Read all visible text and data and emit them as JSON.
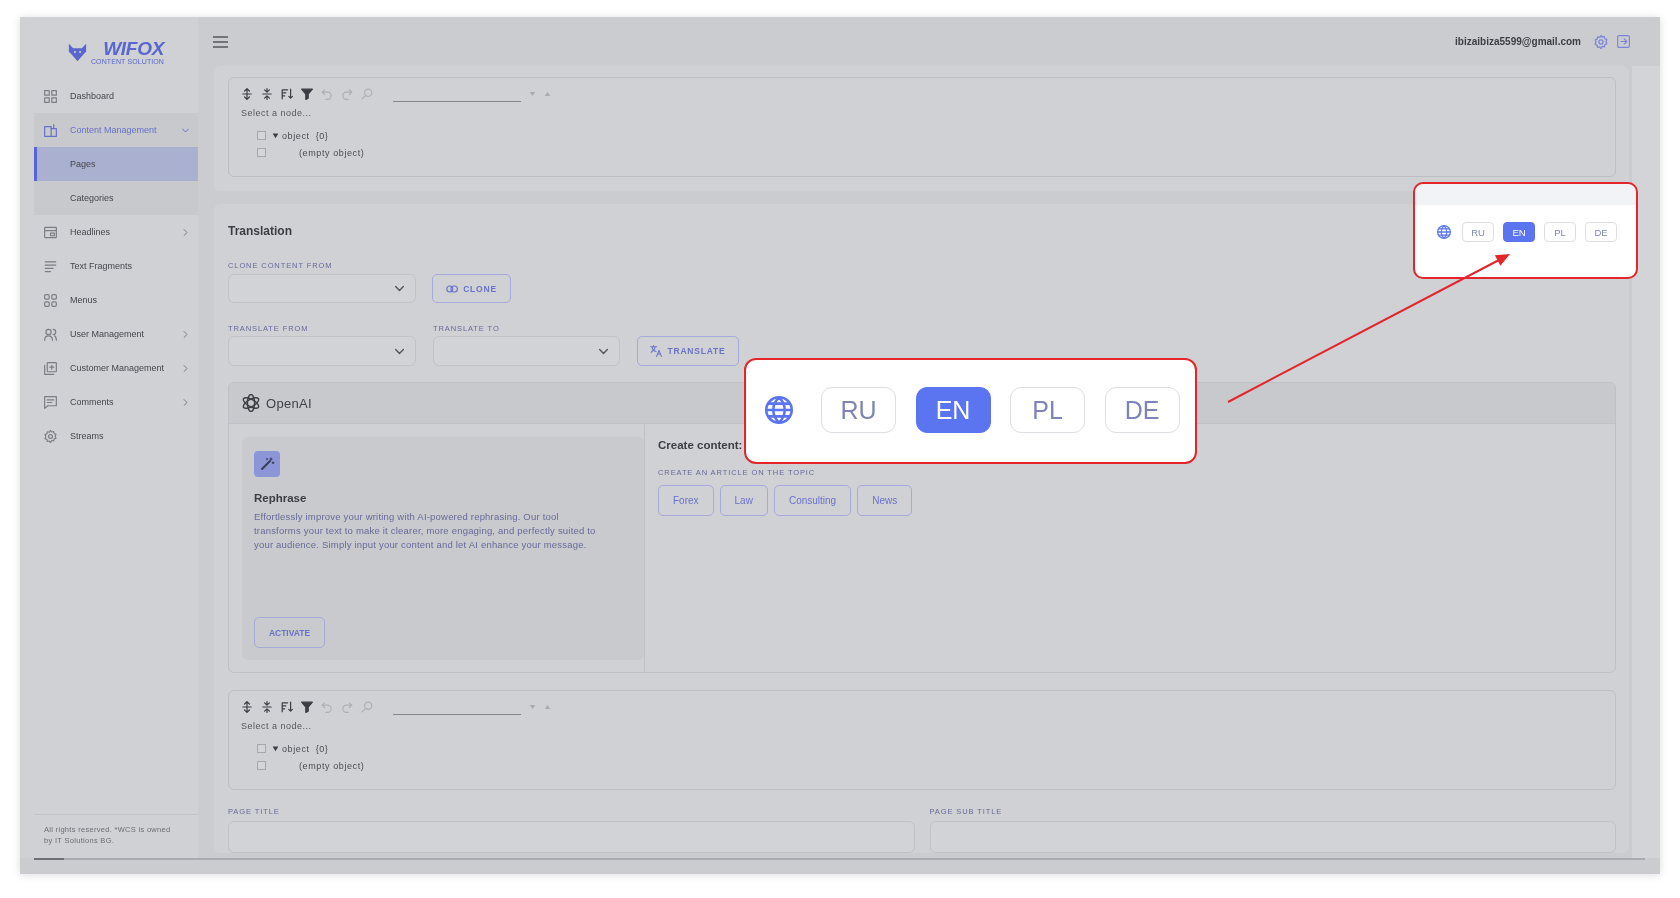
{
  "sidebar": {
    "logo": {
      "name": "WIFOX",
      "tagline": "CONTENT SOLUTION"
    },
    "items": [
      {
        "label": "Dashboard",
        "selected": false
      },
      {
        "label": "Content Management",
        "selected": false,
        "expanded": true,
        "children": [
          {
            "label": "Pages",
            "selected": true
          },
          {
            "label": "Categories",
            "selected": false
          }
        ]
      },
      {
        "label": "Headlines",
        "selected": false,
        "expanded": false
      },
      {
        "label": "Text Fragments",
        "selected": false
      },
      {
        "label": "Menus",
        "selected": false
      },
      {
        "label": "User Management",
        "selected": false,
        "expanded": false
      },
      {
        "label": "Customer Management",
        "selected": false,
        "expanded": false
      },
      {
        "label": "Comments",
        "selected": false,
        "expanded": false
      },
      {
        "label": "Streams",
        "selected": false
      }
    ],
    "footer": "All rights reserved. *WCS is owned by IT Solutions BG."
  },
  "header": {
    "user_email": "ibizaibiza5599@gmail.com"
  },
  "json_editors": [
    {
      "toolbar": [
        {
          "disabled": false
        },
        {
          "disabled": false
        },
        {
          "disabled": false
        },
        {
          "disabled": false
        },
        {
          "disabled": true
        },
        {
          "disabled": true
        },
        {
          "disabled": true
        }
      ],
      "status": "Select a node...",
      "tree": [
        {
          "label": "object",
          "count": "{0}",
          "checked": false,
          "expanded": true,
          "children": [
            {
              "label": "(empty object)",
              "checked": false
            }
          ]
        }
      ]
    },
    {
      "toolbar": [
        {
          "disabled": false
        },
        {
          "disabled": false
        },
        {
          "disabled": false
        },
        {
          "disabled": false
        },
        {
          "disabled": true
        },
        {
          "disabled": true
        },
        {
          "disabled": true
        }
      ],
      "status": "Select a node...",
      "tree": [
        {
          "label": "object",
          "count": "{0}",
          "checked": false,
          "expanded": true,
          "children": [
            {
              "label": "(empty object)",
              "checked": false
            }
          ]
        }
      ]
    }
  ],
  "translation": {
    "title": "Translation",
    "clone_from": {
      "label": "CLONE CONTENT FROM"
    },
    "clone_button": "CLONE",
    "translate_from": {
      "label": "TRANSLATE FROM"
    },
    "translate_to": {
      "label": "TRANSLATE TO"
    },
    "translate_button": "TRANSLATE",
    "openai": {
      "title": "OpenAI",
      "tools": [
        {
          "title": "Rephrase",
          "description": "Effortlessly improve your writing with AI-powered rephrasing. Our tool transforms your text to make it clearer, more engaging, and perfectly suited to your audience. Simply input your content and let AI enhance your message.",
          "button": "ACTIVATE"
        }
      ],
      "create_content": {
        "title": "Create content:",
        "label": "CREATE AN ARTICLE ON THE TOPIC",
        "topics": [
          "Forex",
          "Law",
          "Consulting",
          "News"
        ]
      }
    },
    "page_fields": [
      {
        "label": "PAGE TITLE"
      },
      {
        "label": "PAGE SUB TITLE"
      }
    ]
  },
  "highlight_callout": {
    "languages": [
      {
        "label": "RU",
        "selected": false
      },
      {
        "label": "EN",
        "selected": true
      },
      {
        "label": "PL",
        "selected": false
      },
      {
        "label": "DE",
        "selected": false
      }
    ]
  },
  "magnified_callout": {
    "languages": [
      {
        "label": "RU",
        "selected": false
      },
      {
        "label": "EN",
        "selected": true
      },
      {
        "label": "PL",
        "selected": false
      },
      {
        "label": "DE",
        "selected": false
      }
    ]
  }
}
